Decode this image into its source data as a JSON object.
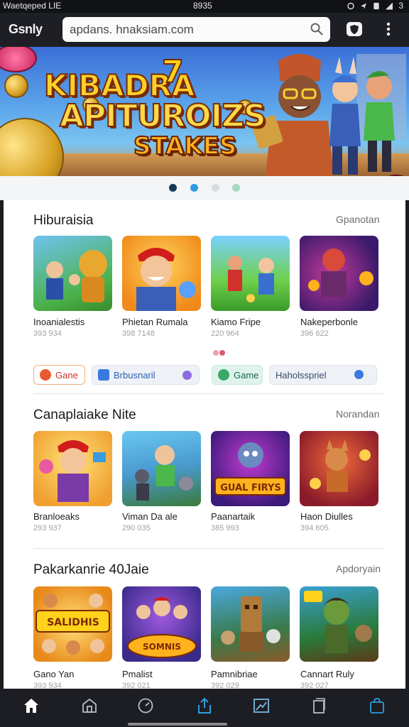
{
  "status_bar": {
    "carrier": "Waetqeped LIE",
    "time": "8935",
    "battery": "3"
  },
  "browser": {
    "brand": "Gsnly",
    "url": "apdans. hnaksiam.com"
  },
  "banner": {
    "headline_1": "KIBADRA",
    "headline_num": "7",
    "headline_2": "APITUROIZS",
    "headline_3": "STAKES"
  },
  "carousel": {
    "dot_count": 4,
    "active_index": 0
  },
  "sections": [
    {
      "title": "Hiburaisia",
      "link": "Gpanotan",
      "items": [
        {
          "name": "Inoanialestis",
          "meta": "393 934"
        },
        {
          "name": "Phietan Rumala",
          "meta": "398 7148"
        },
        {
          "name": "Kiamo Fripe",
          "meta": "220 964"
        },
        {
          "name": "Nakeperbonle",
          "meta": "396 622"
        }
      ]
    },
    {
      "title": "Canaplaiake Nite",
      "link": "Norandan",
      "items": [
        {
          "name": "Branloeaks",
          "meta": "293 937"
        },
        {
          "name": "Viman Da ale",
          "meta": "290 035"
        },
        {
          "name": "Paanartaik",
          "meta": "385 993"
        },
        {
          "name": "Haon Diulles",
          "meta": "394 605"
        }
      ]
    },
    {
      "title": "Pakarkanrie 40Jaie",
      "link": "Apdoryain",
      "items": [
        {
          "name": "Gano Yan",
          "meta": "393 934"
        },
        {
          "name": "Pmalist",
          "meta": "392 021"
        },
        {
          "name": "Pamnibriae",
          "meta": "392 029"
        },
        {
          "name": "Cannart Ruly",
          "meta": "392 027"
        }
      ]
    }
  ],
  "tile_art_labels": {
    "s2_i2": "GUAL FIRYS",
    "s3_i0": "SALIDHIS",
    "s3_i1": "SOMNIS"
  },
  "chips": [
    {
      "label": "Gane",
      "icon": "game-icon"
    },
    {
      "label": "Brbusnaril",
      "icon": "calendar-icon"
    },
    {
      "label": "Game",
      "icon": "controller-icon"
    },
    {
      "label": "Haholsspriel",
      "icon": "info-icon"
    }
  ],
  "colors": {
    "accent": "#1f7ee0",
    "dot_active": "#173a5a",
    "dot_second": "#2e9de0",
    "chip_game_bg": "#dff3ec"
  },
  "bottom_nav": [
    {
      "icon": "home-icon",
      "active": true
    },
    {
      "icon": "store-icon"
    },
    {
      "icon": "compass-icon"
    },
    {
      "icon": "share-icon"
    },
    {
      "icon": "map-icon"
    },
    {
      "icon": "tabs-icon"
    },
    {
      "icon": "bag-icon"
    }
  ]
}
